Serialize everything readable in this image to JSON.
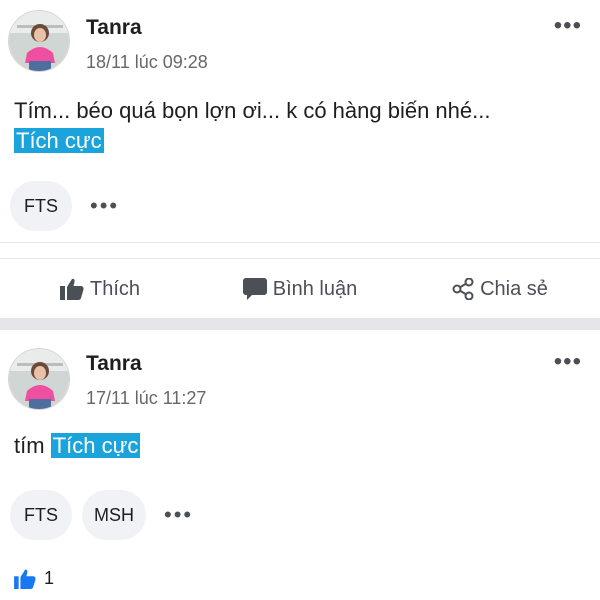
{
  "posts": [
    {
      "author": "Tanra",
      "timestamp": "18/11 lúc 09:28",
      "text": "Tím... béo quá bọn lợn ơi... k có hàng biến nhé...",
      "tag": "Tích cực",
      "chips": [
        "FTS"
      ],
      "chip_more": "•••",
      "more_icon": "•••",
      "actions": {
        "like": "Thích",
        "comment": "Bình luận",
        "share": "Chia sẻ"
      }
    },
    {
      "author": "Tanra",
      "timestamp": "17/11 lúc 11:27",
      "text": "tím",
      "tag": "Tích cực",
      "chips": [
        "FTS",
        "MSH"
      ],
      "chip_more": "•••",
      "more_icon": "•••",
      "likes_count": "1"
    }
  ],
  "colors": {
    "tag_bg": "#1aa4db",
    "like_blue": "#1877f2",
    "separator": "#e4e6ea"
  },
  "icons": [
    "thumbs-up-icon",
    "comment-icon",
    "share-icon",
    "more-icon"
  ]
}
